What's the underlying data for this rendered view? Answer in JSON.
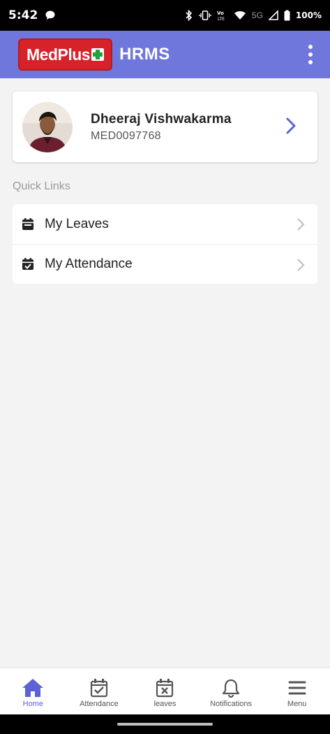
{
  "status_bar": {
    "time": "5:42",
    "battery": "100%",
    "icons": [
      "chat-icon",
      "bluetooth-icon",
      "vibrate-icon",
      "volte-icon",
      "wifi-icon",
      "5g-icon",
      "signal-icon",
      "battery-icon"
    ],
    "network_label": "5G"
  },
  "app_bar": {
    "logo_text": "MedPlus",
    "title": "HRMS",
    "brand_color": "#d7222a",
    "bar_color": "#6f77dc"
  },
  "profile": {
    "name": "Dheeraj Vishwakarma",
    "employee_id": "MED0097768"
  },
  "quick_links": {
    "heading": "Quick Links",
    "items": [
      {
        "label": "My Leaves",
        "icon": "calendar-icon"
      },
      {
        "label": "My Attendance",
        "icon": "calendar-check-icon"
      }
    ]
  },
  "bottom_nav": {
    "items": [
      {
        "label": "Home",
        "icon": "home-icon",
        "active": true
      },
      {
        "label": "Attendance",
        "icon": "calendar-check-icon",
        "active": false
      },
      {
        "label": "leaves",
        "icon": "calendar-x-icon",
        "active": false
      },
      {
        "label": "Notifications",
        "icon": "bell-icon",
        "active": false
      },
      {
        "label": "Menu",
        "icon": "hamburger-icon",
        "active": false
      }
    ],
    "active_color": "#5b62d6"
  }
}
